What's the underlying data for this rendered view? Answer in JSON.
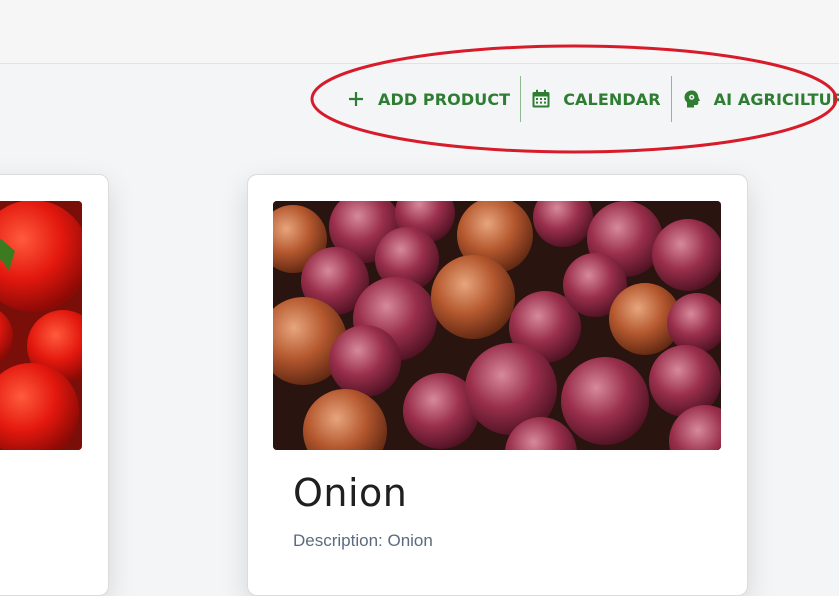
{
  "toolbar": {
    "add_product_label": "ADD PRODUCT",
    "calendar_label": "CALENDAR",
    "ai_agriculture_label": "AI AGRICILTURE"
  },
  "icons": {
    "add": "plus-icon",
    "calendar": "calendar-icon",
    "ai": "brain-head-icon"
  },
  "colors": {
    "accent": "#2e7d32",
    "highlight": "#d81b2a",
    "description": "#5b6b7f"
  },
  "products": [
    {
      "name": "",
      "description": "",
      "image": "tomatoes"
    },
    {
      "name": "Onion",
      "description": "Description: Onion",
      "image": "red onions"
    }
  ]
}
